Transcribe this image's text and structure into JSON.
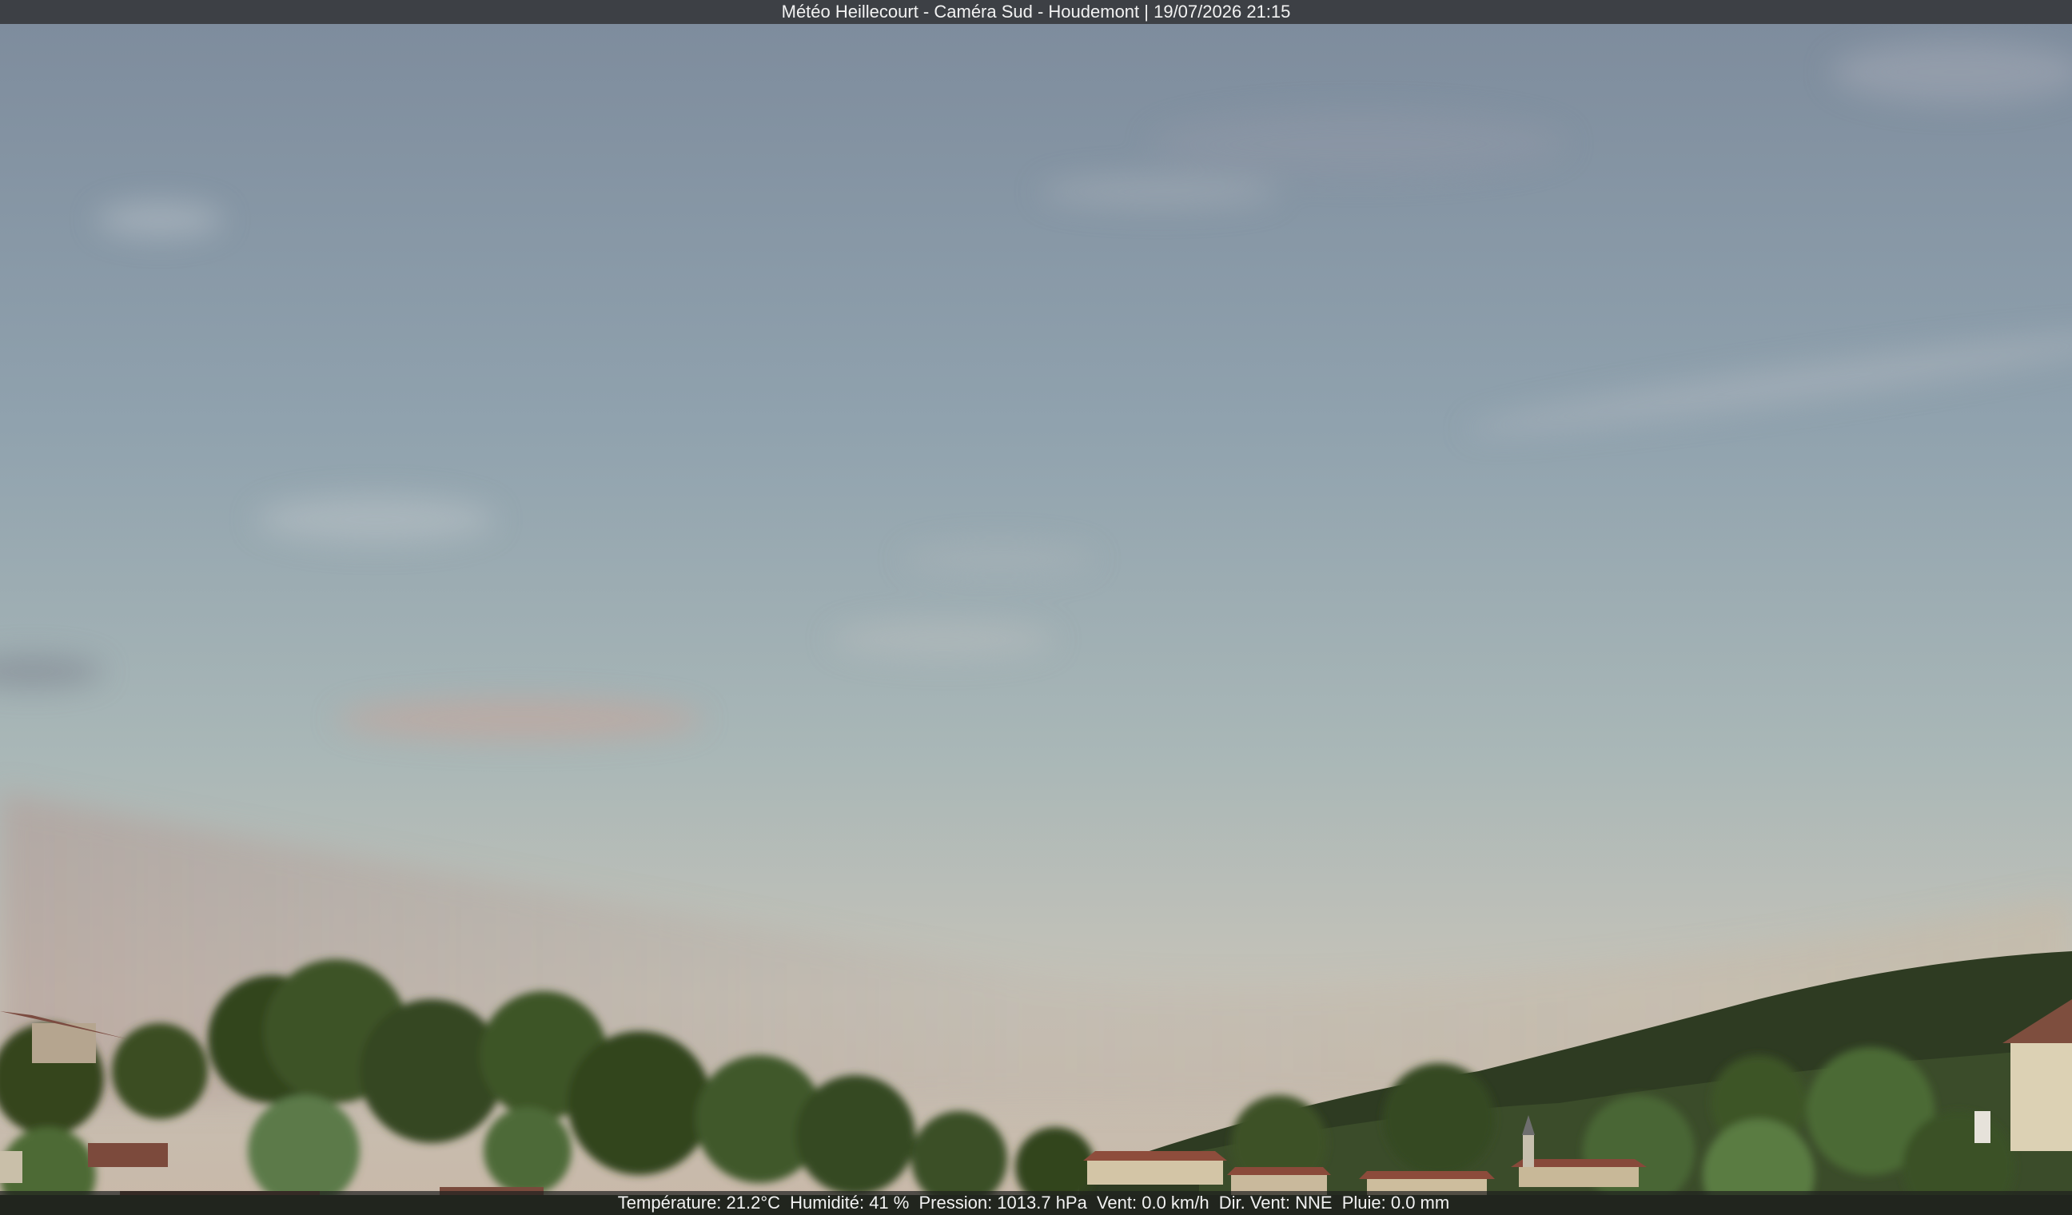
{
  "overlay": {
    "title": "Météo Heillecourt - Caméra Sud - Houdemont | 19/07/2026 21:15",
    "weather": {
      "temperature": "Température: 21.2°C",
      "humidity": "Humidité: 41 %",
      "pressure": "Pression: 1013.7 hPa",
      "wind": "Vent: 0.0 km/h",
      "wind_direction": "Dir. Vent: NNE",
      "rain": "Pluie: 0.0 mm"
    }
  },
  "colors": {
    "sky_top": "#7d8c9d",
    "sky_mid": "#96a8b3",
    "sky_horizon": "#c3c3b8",
    "foliage_dark": "#2b3a1e",
    "foliage_light": "#4d6a34",
    "roof": "#8a4a3a"
  }
}
